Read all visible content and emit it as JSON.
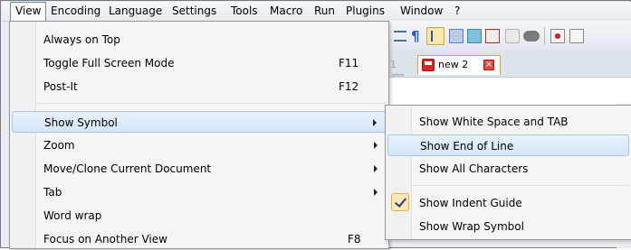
{
  "menubar": {
    "items": [
      "View",
      "Encoding",
      "Language",
      "Settings",
      "Tools",
      "Macro",
      "Run",
      "Plugins",
      "Window",
      "?"
    ]
  },
  "tabs": {
    "ghost_label": "1",
    "active_label": "new 2",
    "close_glyph": "×"
  },
  "view_menu": {
    "items": [
      {
        "label": "Always on Top",
        "shortcut": ""
      },
      {
        "label": "Toggle Full Screen Mode",
        "shortcut": "F11"
      },
      {
        "label": "Post-It",
        "shortcut": "F12"
      },
      {
        "label": "Show Symbol",
        "shortcut": ""
      },
      {
        "label": "Zoom",
        "shortcut": ""
      },
      {
        "label": "Move/Clone Current Document",
        "shortcut": ""
      },
      {
        "label": "Tab",
        "shortcut": ""
      },
      {
        "label": "Word wrap",
        "shortcut": ""
      },
      {
        "label": "Focus on Another View",
        "shortcut": "F8"
      }
    ]
  },
  "show_symbol_menu": {
    "items": [
      {
        "label": "Show White Space and TAB",
        "checked": false
      },
      {
        "label": "Show End of Line",
        "checked": false
      },
      {
        "label": "Show All Characters",
        "checked": false
      },
      {
        "label": "Show Indent Guide",
        "checked": true
      },
      {
        "label": "Show Wrap Symbol",
        "checked": false
      }
    ]
  },
  "colors": {
    "highlight": "#d6e6f8",
    "menu_bg": "#f5f5f5",
    "accent_tab": "#e0a23a"
  }
}
